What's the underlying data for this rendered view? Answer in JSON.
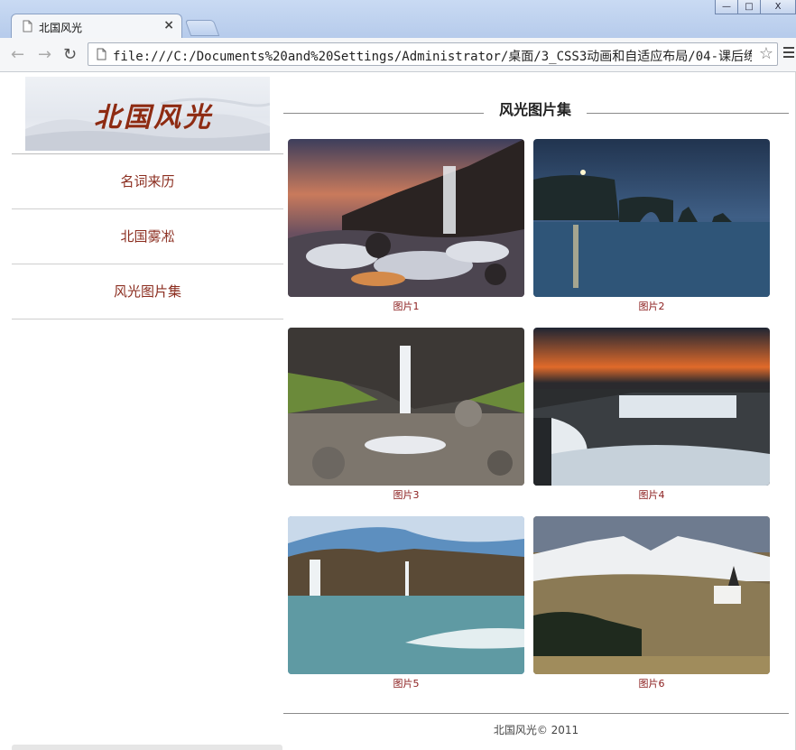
{
  "browser": {
    "tab_title": "北国风光",
    "tab_close": "×",
    "url": "file:///C:/Documents%20and%20Settings/Administrator/桌面/3_CSS3动画和自适应布局/04-课后练",
    "win_min": "—",
    "win_max": "□",
    "win_close": "X"
  },
  "header": {
    "logo_text": "北国风光"
  },
  "nav": {
    "items": [
      {
        "label": "名词来历"
      },
      {
        "label": "北国雾凇"
      },
      {
        "label": "风光图片集"
      }
    ]
  },
  "gallery": {
    "title": "风光图片集",
    "pictures": [
      {
        "caption": "图片1"
      },
      {
        "caption": "图片2"
      },
      {
        "caption": "图片3"
      },
      {
        "caption": "图片4"
      },
      {
        "caption": "图片5"
      },
      {
        "caption": "图片6"
      }
    ]
  },
  "footer": {
    "text": "北国风光© 2011"
  },
  "colors": {
    "accent": "#8b2d1f",
    "caption": "#8b1d1d",
    "chrome": "#b6cbeb"
  },
  "icons": [
    "page-icon",
    "close-icon",
    "back-icon",
    "forward-icon",
    "reload-icon",
    "star-icon",
    "menu-icon"
  ]
}
